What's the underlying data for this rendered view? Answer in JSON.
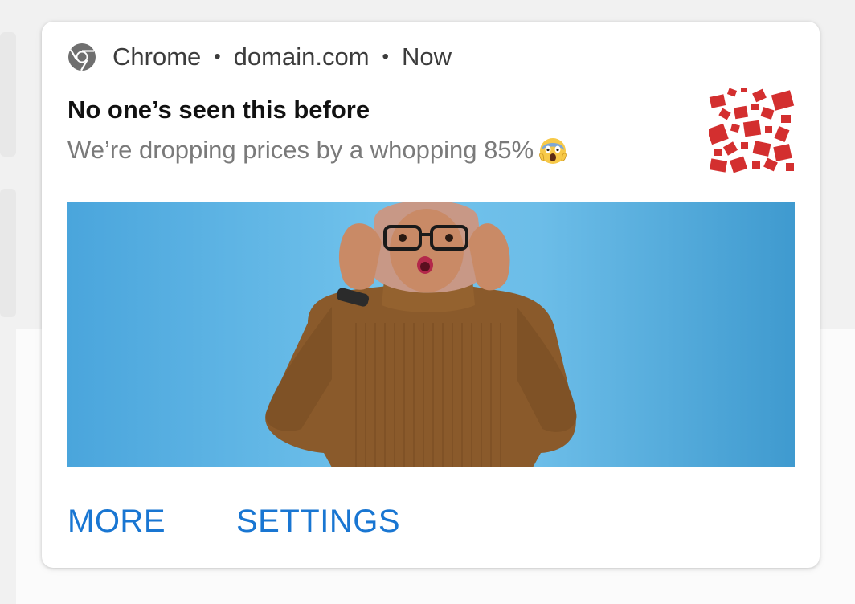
{
  "notification": {
    "app_name": "Chrome",
    "app_icon": "chrome-icon",
    "separator": "•",
    "domain": "domain.com",
    "time": "Now",
    "title": "No one’s seen this before",
    "body": "We’re dropping prices by a whopping 85%",
    "body_emoji": "screaming-face-emoji",
    "thumbnail": "sale-tags-thumbnail",
    "hero_image": "surprised-woman-glasses-photo",
    "actions": [
      {
        "label": "MORE"
      },
      {
        "label": "SETTINGS"
      }
    ]
  },
  "colors": {
    "action_blue": "#1976d2",
    "title": "#111111",
    "body": "#7a7a7a",
    "sale_red": "#d32f2f",
    "sky_blue": "#69bde9",
    "sweater_brown": "#8a5a2b"
  }
}
